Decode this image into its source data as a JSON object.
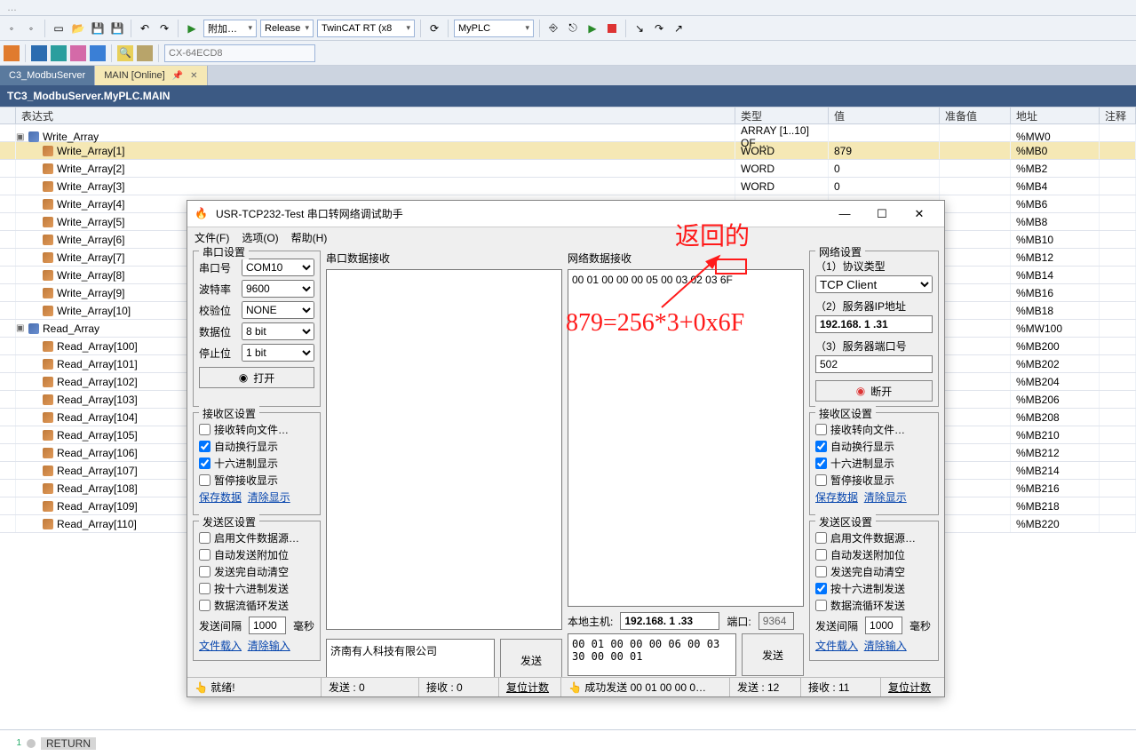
{
  "ide": {
    "topmenu_hint": "…",
    "release": "Release",
    "rt": "TwinCAT RT (x8",
    "plc": "MyPLC",
    "attach": "附加…",
    "search_placeholder": "CX-64ECD8"
  },
  "tabs": {
    "inactive": "C3_ModbuServer",
    "active": "MAIN [Online]"
  },
  "subheader": "TC3_ModbuServer.MyPLC.MAIN",
  "columns": {
    "expr": "表达式",
    "type": "类型",
    "value": "值",
    "prep": "准备值",
    "addr": "地址",
    "comment": "注释"
  },
  "rows": [
    {
      "lv": 0,
      "kind": "arr",
      "name": "Write_Array",
      "type": "ARRAY [1..10] OF …",
      "value": "",
      "addr": "%MW0"
    },
    {
      "lv": 1,
      "kind": "w",
      "sel": true,
      "name": "Write_Array[1]",
      "type": "WORD",
      "value": "879",
      "addr": "%MB0"
    },
    {
      "lv": 1,
      "kind": "w",
      "name": "Write_Array[2]",
      "type": "WORD",
      "value": "0",
      "addr": "%MB2"
    },
    {
      "lv": 1,
      "kind": "w",
      "name": "Write_Array[3]",
      "type": "WORD",
      "value": "0",
      "addr": "%MB4"
    },
    {
      "lv": 1,
      "kind": "w",
      "name": "Write_Array[4]",
      "type": "",
      "value": "",
      "addr": "%MB6"
    },
    {
      "lv": 1,
      "kind": "w",
      "name": "Write_Array[5]",
      "type": "",
      "value": "",
      "addr": "%MB8"
    },
    {
      "lv": 1,
      "kind": "w",
      "name": "Write_Array[6]",
      "type": "",
      "value": "",
      "addr": "%MB10"
    },
    {
      "lv": 1,
      "kind": "w",
      "name": "Write_Array[7]",
      "type": "",
      "value": "",
      "addr": "%MB12"
    },
    {
      "lv": 1,
      "kind": "w",
      "name": "Write_Array[8]",
      "type": "",
      "value": "",
      "addr": "%MB14"
    },
    {
      "lv": 1,
      "kind": "w",
      "name": "Write_Array[9]",
      "type": "",
      "value": "",
      "addr": "%MB16"
    },
    {
      "lv": 1,
      "kind": "w",
      "name": "Write_Array[10]",
      "type": "",
      "value": "",
      "addr": "%MB18"
    },
    {
      "lv": 0,
      "kind": "arr",
      "name": "Read_Array",
      "type": "",
      "value": "",
      "addr": "%MW100"
    },
    {
      "lv": 1,
      "kind": "w",
      "name": "Read_Array[100]",
      "type": "",
      "value": "",
      "addr": "%MB200"
    },
    {
      "lv": 1,
      "kind": "w",
      "name": "Read_Array[101]",
      "type": "",
      "value": "",
      "addr": "%MB202"
    },
    {
      "lv": 1,
      "kind": "w",
      "name": "Read_Array[102]",
      "type": "",
      "value": "",
      "addr": "%MB204"
    },
    {
      "lv": 1,
      "kind": "w",
      "name": "Read_Array[103]",
      "type": "",
      "value": "",
      "addr": "%MB206"
    },
    {
      "lv": 1,
      "kind": "w",
      "name": "Read_Array[104]",
      "type": "",
      "value": "",
      "addr": "%MB208"
    },
    {
      "lv": 1,
      "kind": "w",
      "name": "Read_Array[105]",
      "type": "",
      "value": "",
      "addr": "%MB210"
    },
    {
      "lv": 1,
      "kind": "w",
      "name": "Read_Array[106]",
      "type": "",
      "value": "",
      "addr": "%MB212"
    },
    {
      "lv": 1,
      "kind": "w",
      "name": "Read_Array[107]",
      "type": "",
      "value": "",
      "addr": "%MB214"
    },
    {
      "lv": 1,
      "kind": "w",
      "name": "Read_Array[108]",
      "type": "",
      "value": "",
      "addr": "%MB216"
    },
    {
      "lv": 1,
      "kind": "w",
      "name": "Read_Array[109]",
      "type": "",
      "value": "",
      "addr": "%MB218"
    },
    {
      "lv": 1,
      "kind": "w",
      "name": "Read_Array[110]",
      "type": "",
      "value": "",
      "addr": "%MB220"
    }
  ],
  "code": {
    "line1": "1",
    "return_kw": "RETURN"
  },
  "dialog": {
    "title": "USR-TCP232-Test 串口转网络调试助手",
    "menu": {
      "file": "文件(F)",
      "options": "选项(O)",
      "help": "帮助(H)"
    },
    "serial_settings": {
      "legend": "串口设置",
      "port_label": "串口号",
      "port_value": "COM10",
      "baud_label": "波特率",
      "baud_value": "9600",
      "parity_label": "校验位",
      "parity_value": "NONE",
      "databits_label": "数据位",
      "databits_value": "8 bit",
      "stopbits_label": "停止位",
      "stopbits_value": "1 bit",
      "open_btn": "打开"
    },
    "serial_recv_area": {
      "legend": "串口数据接收",
      "text": ""
    },
    "serial_recv_opts": {
      "legend": "接收区设置",
      "to_file": "接收转向文件…",
      "auto_wrap": "自动换行显示",
      "hex": "十六进制显示",
      "pause": "暂停接收显示",
      "save": "保存数据",
      "clear": "清除显示"
    },
    "serial_send_opts": {
      "legend": "发送区设置",
      "from_file": "启用文件数据源…",
      "append": "自动发送附加位",
      "autoclear": "发送完自动清空",
      "hex": "按十六进制发送",
      "loop": "数据流循环发送",
      "interval_l": "发送间隔",
      "interval_v": "1000",
      "interval_u": "毫秒",
      "load": "文件载入",
      "clear": "清除输入"
    },
    "serial_send": {
      "text": "济南有人科技有限公司",
      "btn": "发送"
    },
    "net_recv_area": {
      "legend": "网络数据接收",
      "text": "00 01 00 00 00 05 00 03 02 ",
      "boxed": "03 6F"
    },
    "net_local": {
      "host_l": "本地主机:",
      "host_v": "192.168. 1 .33",
      "port_l": "端口:",
      "port_v": "9364"
    },
    "net_send": {
      "text": "00 01 00 00 00 06 00 03 30 00 00 01",
      "btn": "发送"
    },
    "net_settings": {
      "legend": "网络设置",
      "proto_l": "（1）协议类型",
      "proto_v": "TCP Client",
      "ip_l": "（2）服务器IP地址",
      "ip_v": "192.168. 1 .31",
      "port_l": "（3）服务器端口号",
      "port_v": "502",
      "disconnect": "断开"
    },
    "net_recv_opts": {
      "legend": "接收区设置",
      "to_file": "接收转向文件…",
      "auto_wrap": "自动换行显示",
      "hex": "十六进制显示",
      "pause": "暂停接收显示",
      "save": "保存数据",
      "clear": "清除显示"
    },
    "net_send_opts": {
      "legend": "发送区设置",
      "from_file": "启用文件数据源…",
      "append": "自动发送附加位",
      "autoclear": "发送完自动清空",
      "hex": "按十六进制发送",
      "loop": "数据流循环发送",
      "interval_l": "发送间隔",
      "interval_v": "1000",
      "interval_u": "毫秒",
      "load": "文件载入",
      "clear": "清除输入"
    },
    "status": {
      "ready_l": "就绪!",
      "s_send": "发送 : 0",
      "s_recv": "接收 : 0",
      "s_reset": "复位计数",
      "n_ok": "成功发送  00 01 00 00 0…",
      "n_send": "发送 : 12",
      "n_recv": "接收 : 11",
      "n_reset": "复位计数"
    }
  },
  "annotations": {
    "returned": "返回的",
    "equation": "879=256*3+0x6F"
  }
}
